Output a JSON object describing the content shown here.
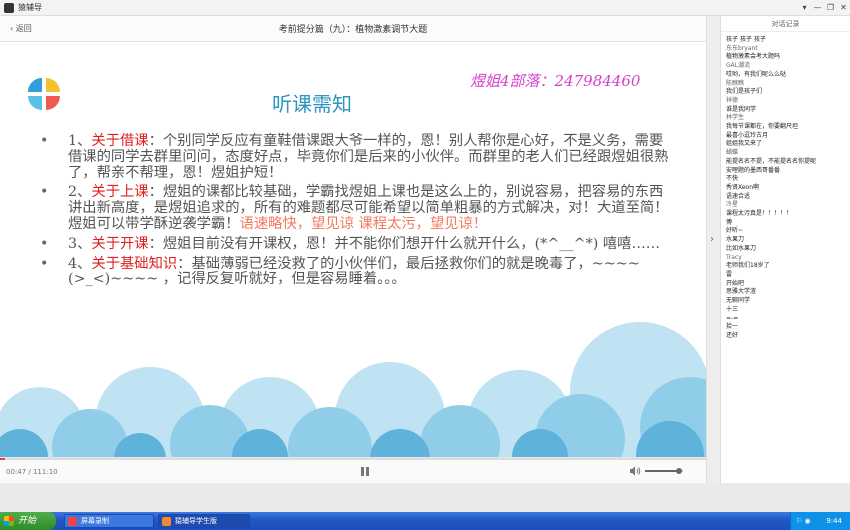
{
  "window": {
    "title": "猿辅导",
    "controls": [
      "▾",
      "—",
      "❐",
      "✕"
    ]
  },
  "topbar": {
    "back_label": "返回",
    "course_title": "考前提分篇（九）：植物激素调节大题"
  },
  "slide": {
    "heading": "听课需知",
    "qq_line": "煜姐4部落：247984460",
    "bullets": [
      {
        "pre": "1、",
        "keyword": "关于借课",
        "body": "：个别同学反应有童鞋借课跟大爷一样的，恩！别人帮你是心好，不是义务，需要借课的同学去群里问问，态度好点，毕竟你们是后来的小伙伴。而群里的老人们已经跟煜姐很熟了，帮亲不帮理，恩！煜姐护短！",
        "highlight": ""
      },
      {
        "pre": "2、",
        "keyword": "关于上课",
        "body": "：煜姐的课都比较基础，学霸找煜姐上课也是这么上的，别说容易，把容易的东西讲出新高度，是煜姐追求的，所有的难题都尽可能希望以简单粗暴的方式解决，对！大道至简！煜姐可以带学酥逆袭学霸！",
        "highlight": "语速略快，望见谅 课程太污，望见谅！"
      },
      {
        "pre": "3、",
        "keyword": "关于开课",
        "body": "：煜姐目前没有开课权，恩！并不能你们想开什么就开什么，(*^__^*) 嘻嘻……",
        "highlight": ""
      },
      {
        "pre": "4、",
        "keyword": "关于基础知识",
        "body": "：基础薄弱已经没救了的小伙伴们，最后拯救你们的就是晚毒了，~~~~(>_<)~~~~ ，记得反复听就好，但是容易睡着。。。",
        "highlight": ""
      }
    ]
  },
  "player": {
    "time": "00:47 / 111:10",
    "progress": 0.007,
    "volume": 0.9
  },
  "chat": {
    "title": "对话记录",
    "messages": [
      {
        "user": "",
        "text": "孩子 孩子 孩子"
      },
      {
        "user": "东东bryant",
        "text": "植物激素会考大题吗"
      },
      {
        "user": "GAL潮流",
        "text": "哎哟，有我们呢么么哒"
      },
      {
        "user": "陈瞧瞧",
        "text": "我们是孩子们"
      },
      {
        "user": "祥德",
        "text": "谁是我同学"
      },
      {
        "user": "林学生",
        "text": "我每节课都在，你要翻尺坦"
      },
      {
        "user": "",
        "text": "最喜小逗玲古月"
      },
      {
        "user": "",
        "text": "姐姐我又来了"
      },
      {
        "user": "蝴蝶",
        "text": "能提名名不提，不能提名名你提呢"
      },
      {
        "user": "",
        "text": "安哩题的墨西哥番番"
      },
      {
        "user": "",
        "text": "不快"
      },
      {
        "user": "",
        "text": "秀贤Xeon啊"
      },
      {
        "user": "",
        "text": "语速合适"
      },
      {
        "user": "冷星",
        "text": "课程太污真是！！！！！"
      },
      {
        "user": "",
        "text": "傅"
      },
      {
        "user": "",
        "text": "好听~"
      },
      {
        "user": "",
        "text": "水果刀"
      },
      {
        "user": "",
        "text": "比如水果刀"
      },
      {
        "user": "Tracy",
        "text": "老师我们18岁了"
      },
      {
        "user": "",
        "text": "雷"
      },
      {
        "user": "",
        "text": "开始吧"
      },
      {
        "user": "",
        "text": "思雅大学渣"
      },
      {
        "user": "",
        "text": "无聊同学"
      },
      {
        "user": "",
        "text": "十三"
      },
      {
        "user": "",
        "text": "=-="
      },
      {
        "user": "",
        "text": "拾一"
      },
      {
        "user": "",
        "text": "还好"
      }
    ]
  },
  "taskbar": {
    "start_label": "开始",
    "tasks": [
      {
        "label": "屏幕录制",
        "color": "#e44"
      },
      {
        "label": "猿辅导学生版",
        "color": "#f08a2a"
      }
    ],
    "clock": "9:44"
  },
  "colors": {
    "accent": "#2e95c2",
    "keyword": "#e02020",
    "highlight": "#f17a5c",
    "qq": "#d640c8"
  }
}
